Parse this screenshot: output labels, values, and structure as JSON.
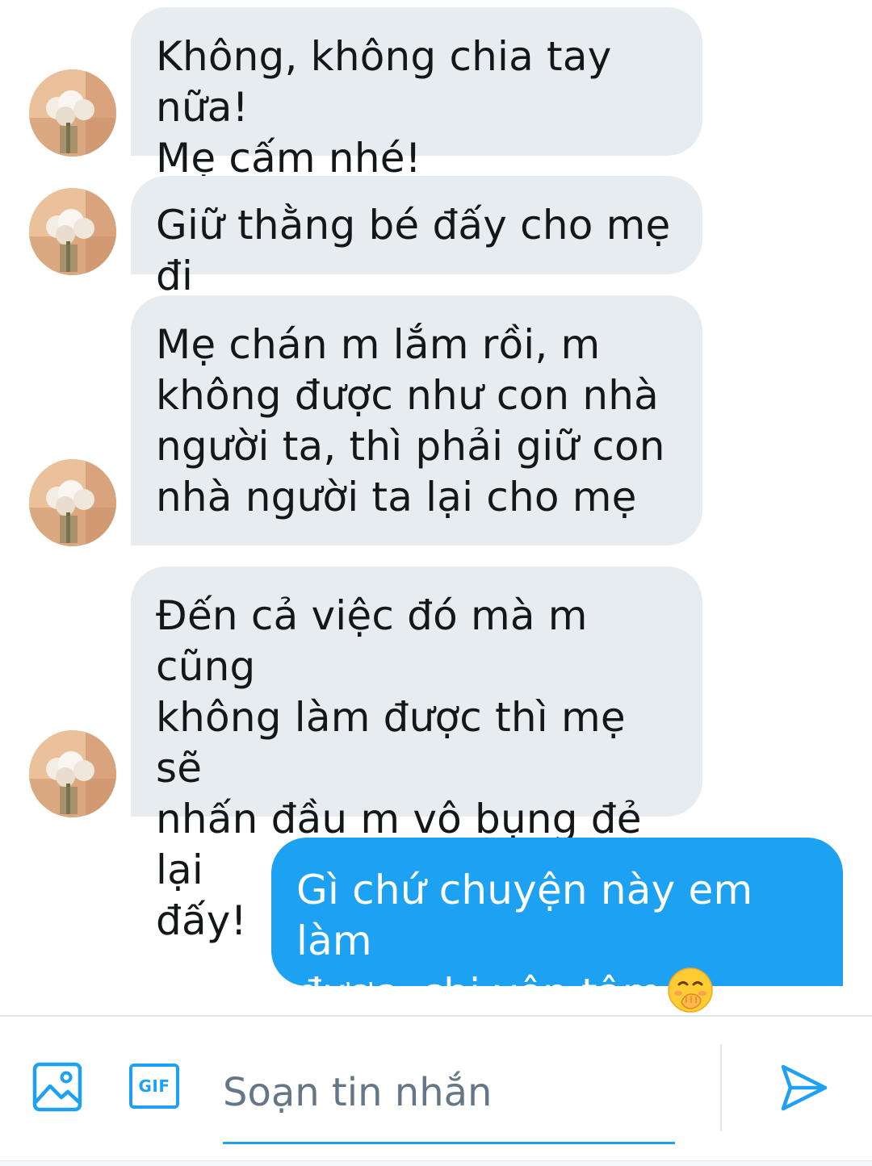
{
  "conversation": {
    "messages": [
      {
        "direction": "in",
        "text": "Không, không chia tay nữa!\nMẹ cấm nhé!"
      },
      {
        "direction": "in",
        "text": "Giữ thằng bé đấy cho mẹ đi"
      },
      {
        "direction": "in",
        "text": "Mẹ chán m lắm rồi, m\nkhông được như con nhà\nngười ta, thì phải giữ con\nnhà người ta lại cho mẹ"
      },
      {
        "direction": "in",
        "text": "Đến cả việc đó mà m cũng\nkhông làm được thì mẹ sẽ\nnhấn đầu m vô bụng đẻ lại\nđấy!"
      },
      {
        "direction": "out",
        "text": "Gì chứ chuyện này em làm\nđược, chị yên tâm",
        "emoji": "face-with-hand-over-mouth"
      }
    ]
  },
  "composer": {
    "placeholder": "Soạn tin nhắn",
    "media_icon": "image-icon",
    "gif_label": "GIF",
    "send_icon": "send-icon"
  },
  "colors": {
    "accent": "#1da1f2",
    "incoming_bubble": "#e6ecf0",
    "text": "#14171a",
    "placeholder": "#657786"
  }
}
